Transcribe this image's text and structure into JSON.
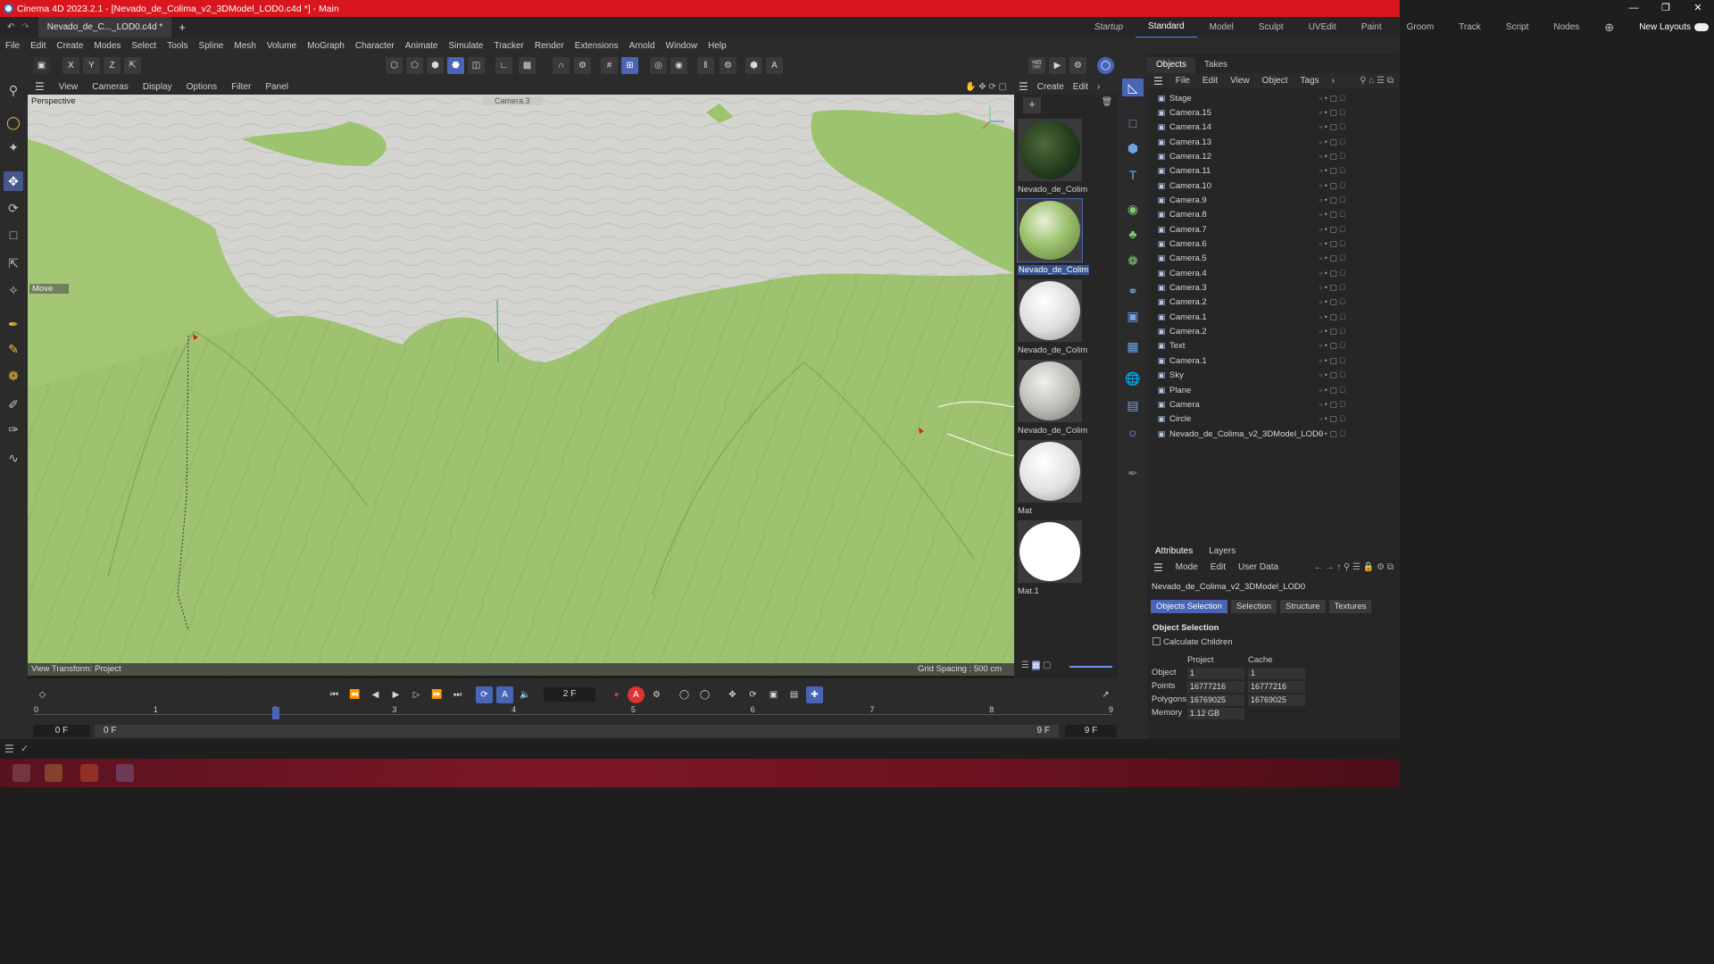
{
  "app": {
    "title": "Cinema 4D 2023.2.1 - [Nevado_de_Colima_v2_3DModel_LOD0.c4d *] - Main",
    "doc_tab": "Nevado_de_C..._LOD0.c4d *",
    "new_tab": "+"
  },
  "layouts": [
    "Startup",
    "Standard",
    "Model",
    "Sculpt",
    "UVEdit",
    "Paint",
    "Groom",
    "Track",
    "Script",
    "Nodes"
  ],
  "layouts_active": "Standard",
  "new_layouts": "New Layouts",
  "menu": [
    "File",
    "Edit",
    "Create",
    "Modes",
    "Select",
    "Tools",
    "Spline",
    "Mesh",
    "Volume",
    "MoGraph",
    "Character",
    "Animate",
    "Simulate",
    "Tracker",
    "Render",
    "Extensions",
    "Arnold",
    "Window",
    "Help"
  ],
  "axes": {
    "x": "X",
    "y": "Y",
    "z": "Z"
  },
  "viewport": {
    "menu": [
      "View",
      "Cameras",
      "Display",
      "Options",
      "Filter",
      "Panel"
    ],
    "label": "Perspective",
    "camera": "Camera.3",
    "tool_label": "Move",
    "bottom_left": "View Transform: Project",
    "bottom_right": "Grid Spacing : 500 cm"
  },
  "materials": {
    "menu": [
      "Create",
      "Edit"
    ],
    "items": [
      "Nevado_de_Colim",
      "Nevado_de_Colim",
      "Nevado_de_Colim",
      "Nevado_de_Colim",
      "Mat",
      "Mat.1"
    ]
  },
  "objects": {
    "tabs": [
      "Objects",
      "Takes"
    ],
    "menu": [
      "File",
      "Edit",
      "View",
      "Object",
      "Tags"
    ],
    "items": [
      {
        "name": "Stage"
      },
      {
        "name": "Camera.15"
      },
      {
        "name": "Camera.14"
      },
      {
        "name": "Camera.13"
      },
      {
        "name": "Camera.12"
      },
      {
        "name": "Camera.11"
      },
      {
        "name": "Camera.10"
      },
      {
        "name": "Camera.9"
      },
      {
        "name": "Camera.8"
      },
      {
        "name": "Camera.7"
      },
      {
        "name": "Camera.6"
      },
      {
        "name": "Camera.5"
      },
      {
        "name": "Camera.4"
      },
      {
        "name": "Camera.3"
      },
      {
        "name": "Camera.2"
      },
      {
        "name": "Camera.1"
      },
      {
        "name": "Camera.2"
      },
      {
        "name": "Text"
      },
      {
        "name": "Camera.1"
      },
      {
        "name": "Sky"
      },
      {
        "name": "Plane"
      },
      {
        "name": "Camera"
      },
      {
        "name": "Circle"
      },
      {
        "name": "Nevado_de_Colima_v2_3DModel_LOD0"
      }
    ]
  },
  "attributes": {
    "tabs": [
      "Attributes",
      "Layers"
    ],
    "menu": [
      "Mode",
      "Edit",
      "User Data"
    ],
    "object_name": "Nevado_de_Colima_v2_3DModel_LOD0",
    "subtabs": [
      "Objects Selection",
      "Selection",
      "Structure",
      "Textures"
    ],
    "section": "Object Selection",
    "calc_children": "Calculate Children",
    "col_project": "Project",
    "col_cache": "Cache",
    "rows": [
      {
        "label": "Object",
        "project": "1",
        "cache": "1"
      },
      {
        "label": "Points",
        "project": "16777216",
        "cache": "16777216"
      },
      {
        "label": "Polygons",
        "project": "16769025",
        "cache": "16769025"
      },
      {
        "label": "Memory",
        "project": "1.12 GB",
        "cache": ""
      }
    ]
  },
  "timeline": {
    "current_frame": "2 F",
    "ticks": [
      "0",
      "1",
      "2",
      "3",
      "4",
      "5",
      "6",
      "7",
      "8",
      "9"
    ],
    "start": "0 F",
    "start2": "0 F",
    "end": "9 F",
    "end2": "9 F"
  },
  "colors": {
    "title_red": "#d9151d",
    "accent_blue": "#4a64b6",
    "terrain_green": "#9cc06f",
    "snow_gray": "#cfd0cb"
  }
}
